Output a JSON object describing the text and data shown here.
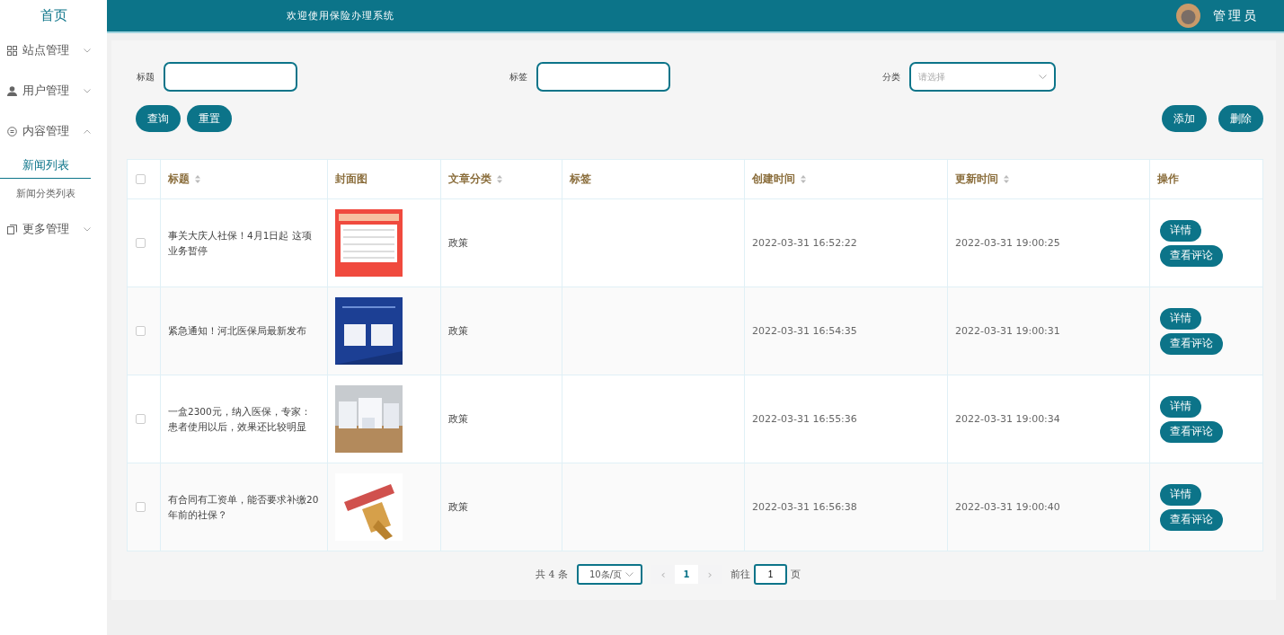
{
  "sidebar": {
    "home": "首页",
    "items": [
      {
        "label": "站点管理",
        "expanded": false
      },
      {
        "label": "用户管理",
        "expanded": false
      },
      {
        "label": "内容管理",
        "expanded": true,
        "children": [
          {
            "label": "新闻列表",
            "selected": true
          },
          {
            "label": "新闻分类列表",
            "selected": false
          }
        ]
      },
      {
        "label": "更多管理",
        "expanded": false
      }
    ]
  },
  "header": {
    "title": "欢迎使用保险办理系统",
    "user": "管理员"
  },
  "filters": [
    {
      "label": "标题",
      "kind": "input"
    },
    {
      "label": "标签",
      "kind": "input"
    },
    {
      "label": "分类",
      "kind": "select",
      "placeholder": "请选择"
    }
  ],
  "left_buttons": [
    "查询",
    "重置"
  ],
  "right_buttons": [
    "添加",
    "删除"
  ],
  "table": {
    "all_checked": false,
    "columns": [
      {
        "label": "标题",
        "sortable": true
      },
      {
        "label": "封面图",
        "sortable": false
      },
      {
        "label": "文章分类",
        "sortable": true
      },
      {
        "label": "标签",
        "sortable": false
      },
      {
        "label": "创建时间",
        "sortable": true
      },
      {
        "label": "更新时间",
        "sortable": true
      },
      {
        "label": "操作",
        "sortable": false
      }
    ],
    "rows": [
      {
        "checked": false,
        "title": "事关大庆人社保！4月1日起 这项业务暂停",
        "category": "政策",
        "created": "2022-03-31 16:52:22",
        "updated": "2022-03-31 19:00:25",
        "actions": [
          "详情",
          "查看评论"
        ]
      },
      {
        "checked": false,
        "title": "紧急通知！河北医保局最新发布",
        "category": "政策",
        "created": "2022-03-31 16:54:35",
        "updated": "2022-03-31 19:00:31",
        "actions": [
          "详情",
          "查看评论"
        ]
      },
      {
        "checked": false,
        "title": "一盒2300元，纳入医保，专家：患者使用以后，效果还比较明显",
        "category": "政策",
        "created": "2022-03-31 16:55:36",
        "updated": "2022-03-31 19:00:34",
        "actions": [
          "详情",
          "查看评论"
        ]
      },
      {
        "checked": false,
        "title": "有合同有工资单，能否要求补缴20年前的社保？",
        "category": "政策",
        "created": "2022-03-31 16:56:38",
        "updated": "2022-03-31 19:00:40",
        "actions": [
          "详情",
          "查看评论"
        ]
      }
    ]
  },
  "pagination": {
    "total": "共 4 条",
    "page_size": "10条/页",
    "prev": "‹",
    "pages": [
      {
        "label": "1",
        "selected": true
      }
    ],
    "next": "›",
    "goto_label": "前往",
    "goto_value": "1",
    "goto_suffix": "页"
  }
}
